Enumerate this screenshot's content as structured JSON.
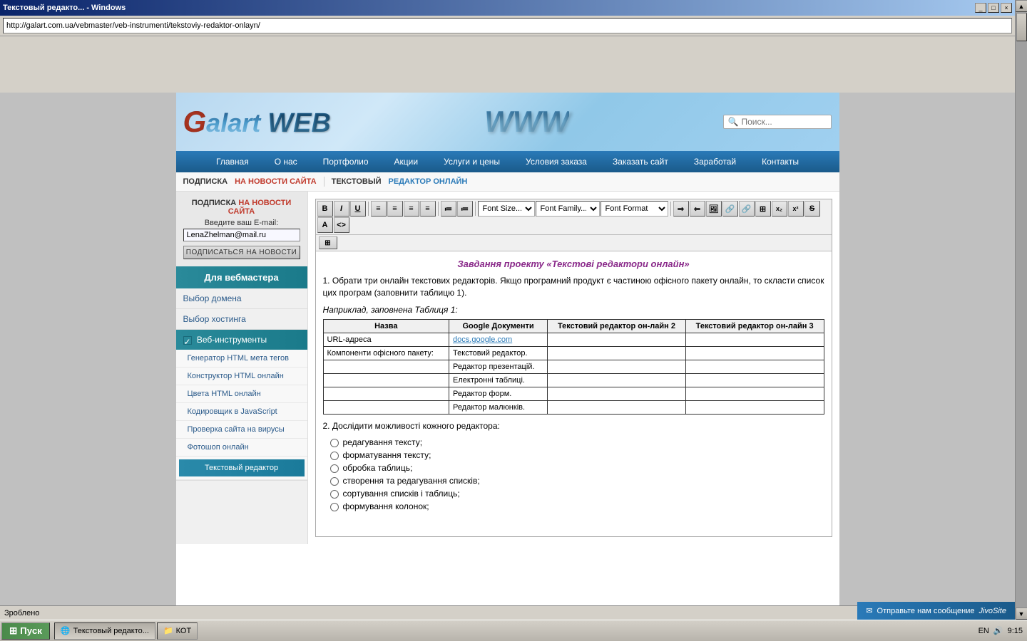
{
  "window": {
    "title": "Текстовый редакто... - Windows"
  },
  "browser": {
    "address": "http://galart.com.ua/vebmaster/veb-instrumenti/tekstoviy-redaktor-onlayn/",
    "search_placeholder": "Поиск..."
  },
  "header": {
    "logo_g": "G",
    "logo_alart": "alart",
    "logo_web": "WEB",
    "logo_www": "WWW"
  },
  "nav": {
    "items": [
      "Главная",
      "О нас",
      "Портфолио",
      "Акции",
      "Услуги и цены",
      "Условия заказа",
      "Заказать сайт",
      "Заработай",
      "Контакты"
    ]
  },
  "sidebar": {
    "subscription": {
      "title": "ПОДПИСКА",
      "link_text": "НА НОВОСТИ САЙТА",
      "email_label": "Введите ваш E-mail:",
      "email_value": "LenaZhelman@mail.ru",
      "button_label": "ПОДПИСАТЬСЯ НА НОВОСТИ"
    },
    "section_title": "Для вебмастера",
    "menu_items": [
      {
        "label": "Выбор домена",
        "active": false,
        "submenu": []
      },
      {
        "label": "Выбор хостинга",
        "active": false,
        "submenu": []
      },
      {
        "label": "Веб-инструменты",
        "active": true,
        "submenu": [
          {
            "label": "Генератор HTML мета тегов",
            "active": false
          },
          {
            "label": "Конструктор HTML онлайн",
            "active": false
          },
          {
            "label": "Цвета HTML онлайн",
            "active": false
          },
          {
            "label": "Кодировщик в JavaScript",
            "active": false
          },
          {
            "label": "Проверка сайта на вирусы",
            "active": false
          },
          {
            "label": "Фотошоп онлайн",
            "active": false
          },
          {
            "label": "Текстовый редактор",
            "active": true
          }
        ]
      }
    ]
  },
  "page": {
    "subscription_prefix": "ПОДПИСКА",
    "subscription_link": "НА НОВОСТИ САЙТА",
    "editor_section": "ТЕКСТОВЫЙ РЕДАКТОР ОНЛАЙН"
  },
  "editor": {
    "toolbar": {
      "bold": "B",
      "italic": "I",
      "underline": "U",
      "align_left": "≡",
      "align_center": "≡",
      "align_right": "≡",
      "align_justify": "≡",
      "list_ol": "≡",
      "list_ul": "≡",
      "font_size_placeholder": "Font Size...",
      "font_family_placeholder": "Font Family...",
      "font_format_placeholder": "Font Format"
    },
    "content": {
      "title": "Завдання проекту «Текстові редактори онлайн»",
      "paragraph1": "1. Обрати три онлайн текстових редакторів. Якщо програмний продукт є частиною офісного пакету онлайн, то скласти список цих програм (заповнити таблицю 1).",
      "example_label": "Наприклад, заповнена Таблиця 1:",
      "table": {
        "headers": [
          "Назва",
          "Google Документи",
          "Текстовий редактор он-лайн 2",
          "Текстовий редактор он-лайн 3"
        ],
        "rows": [
          [
            "URL-адреса",
            "docs.google.com",
            "",
            ""
          ],
          [
            "Компоненти офісного пакету:",
            "Текстовий редактор.",
            "",
            ""
          ],
          [
            "",
            "Редактор презентацій.",
            "",
            ""
          ],
          [
            "",
            "Електронні таблиці.",
            "",
            ""
          ],
          [
            "",
            "Редактор форм.",
            "",
            ""
          ],
          [
            "",
            "Редактор малюнків.",
            "",
            ""
          ]
        ]
      },
      "paragraph2": "2. Дослідити можливості кожного редактора:",
      "list_items": [
        "редагування тексту;",
        "форматування тексту;",
        "обробка таблиць;",
        "створення та редагування списків;",
        "сортування списків і таблиць;",
        "формування колонок;"
      ]
    }
  },
  "chat_widget": {
    "label": "Отправьте нам сообщение",
    "provider": "JivoSite"
  },
  "statusbar": {
    "text": "Зроблено"
  },
  "taskbar": {
    "start_label": "Пуск",
    "items": [
      {
        "label": "Текстовый редакто...",
        "active": true
      },
      {
        "label": "КОТ",
        "active": false
      }
    ],
    "time": "9:15"
  }
}
